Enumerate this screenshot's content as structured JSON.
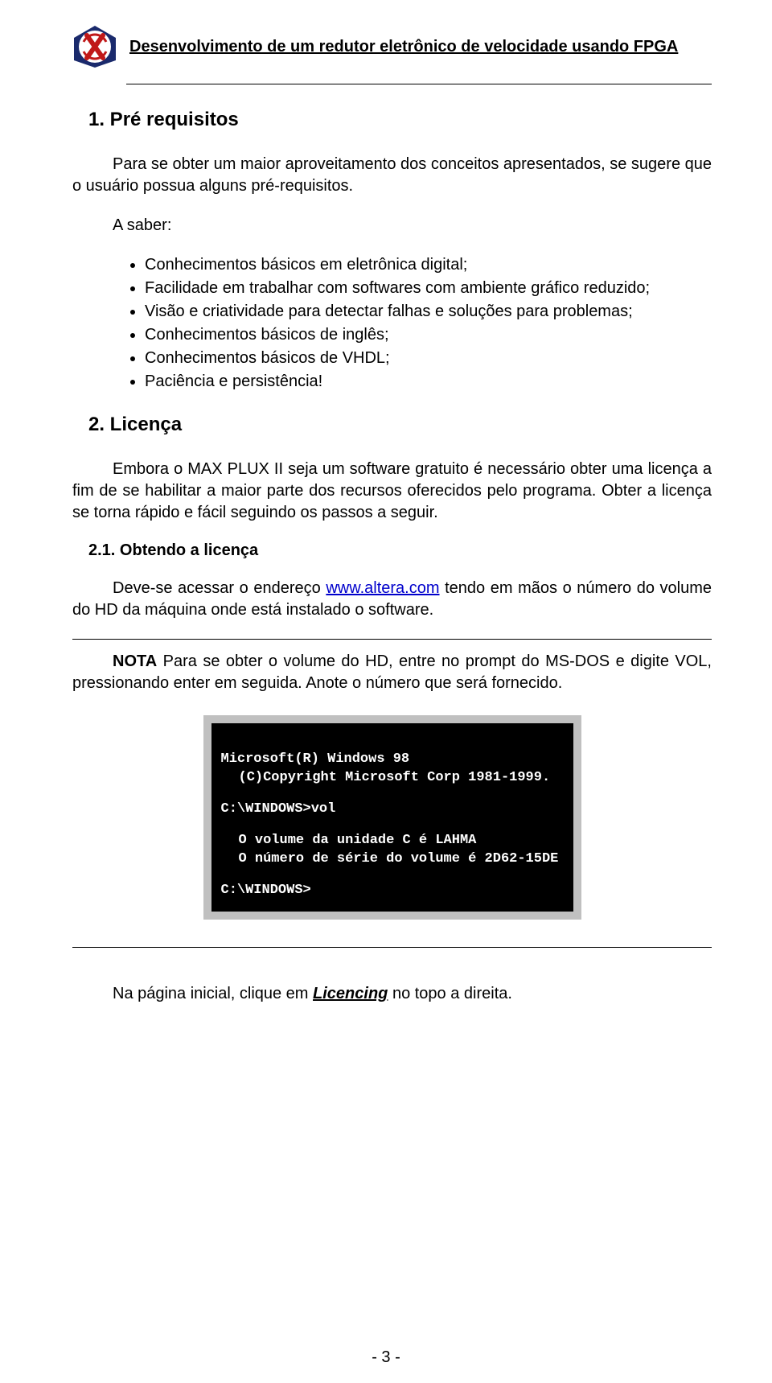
{
  "header": {
    "title": "Desenvolvimento de um redutor eletrônico de velocidade usando FPGA"
  },
  "sec1": {
    "heading": "1. Pré requisitos",
    "intro": "Para se obter um maior aproveitamento dos conceitos apresentados, se sugere que o usuário possua alguns pré-requisitos.",
    "asaber": "A saber:",
    "bullets": [
      "Conhecimentos básicos em eletrônica digital;",
      "Facilidade em trabalhar com softwares com ambiente gráfico reduzido;",
      "Visão e criatividade para detectar falhas e soluções para problemas;",
      "Conhecimentos básicos de inglês;",
      "Conhecimentos básicos de VHDL;",
      "Paciência e persistência!"
    ]
  },
  "sec2": {
    "heading": "2. Licença",
    "para1": "Embora o MAX PLUX II seja um software gratuito é necessário obter uma licença a fim de se habilitar a maior parte dos recursos oferecidos pelo programa. Obter a licença se torna rápido e fácil seguindo os passos a seguir.",
    "sub21_heading": "2.1. Obtendo a licença",
    "para2_pre": "Deve-se acessar o endereço  ",
    "link_text": "www.altera.com",
    "para2_post": " tendo em mãos o número do volume do HD da máquina onde está instalado o software.",
    "note_lead": "NOTA",
    "note_rest": "  Para se obter o volume do HD, entre no prompt do MS-DOS e digite VOL, pressionando enter em seguida. Anote o número que será fornecido.",
    "terminal": {
      "l1": "Microsoft(R)  Windows 98",
      "l2": "(C)Copyright Microsoft Corp 1981-1999.",
      "l3": "C:\\WINDOWS>vol",
      "l4": "O volume da unidade C é LAHMA",
      "l5": "O número de série do volume é 2D62-15DE",
      "l6": "C:\\WINDOWS>"
    },
    "final_pre": "Na página inicial, clique em ",
    "licencing": "Licencing",
    "final_post": " no topo a direita."
  },
  "page_num": "- 3 -"
}
